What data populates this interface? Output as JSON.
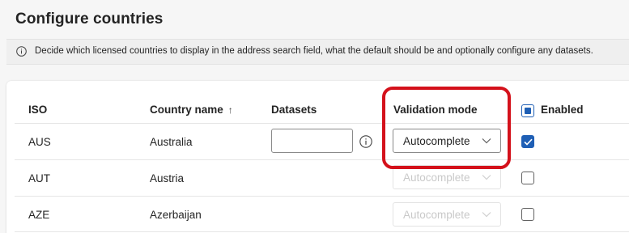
{
  "page": {
    "title": "Configure countries",
    "info_text": "Decide which licensed countries to display in the address search field, what the default should be and optionally configure any datasets."
  },
  "table": {
    "headers": {
      "iso": "ISO",
      "country_name": "Country name",
      "sort_indicator": "↑",
      "datasets": "Datasets",
      "validation_mode": "Validation mode",
      "enabled": "Enabled"
    },
    "rows": [
      {
        "iso": "AUS",
        "country": "Australia",
        "validation_mode": "Autocomplete",
        "enabled": true,
        "dataset_value": ""
      },
      {
        "iso": "AUT",
        "country": "Austria",
        "validation_mode": "Autocomplete",
        "enabled": false
      },
      {
        "iso": "AZE",
        "country": "Azerbaijan",
        "validation_mode": "Autocomplete",
        "enabled": false
      }
    ]
  },
  "colors": {
    "accent": "#1f5fb5",
    "highlight": "#d4111b"
  },
  "icons": {
    "info": "info-icon",
    "chevron": "chevron-down-icon",
    "check": "checkmark-icon"
  }
}
